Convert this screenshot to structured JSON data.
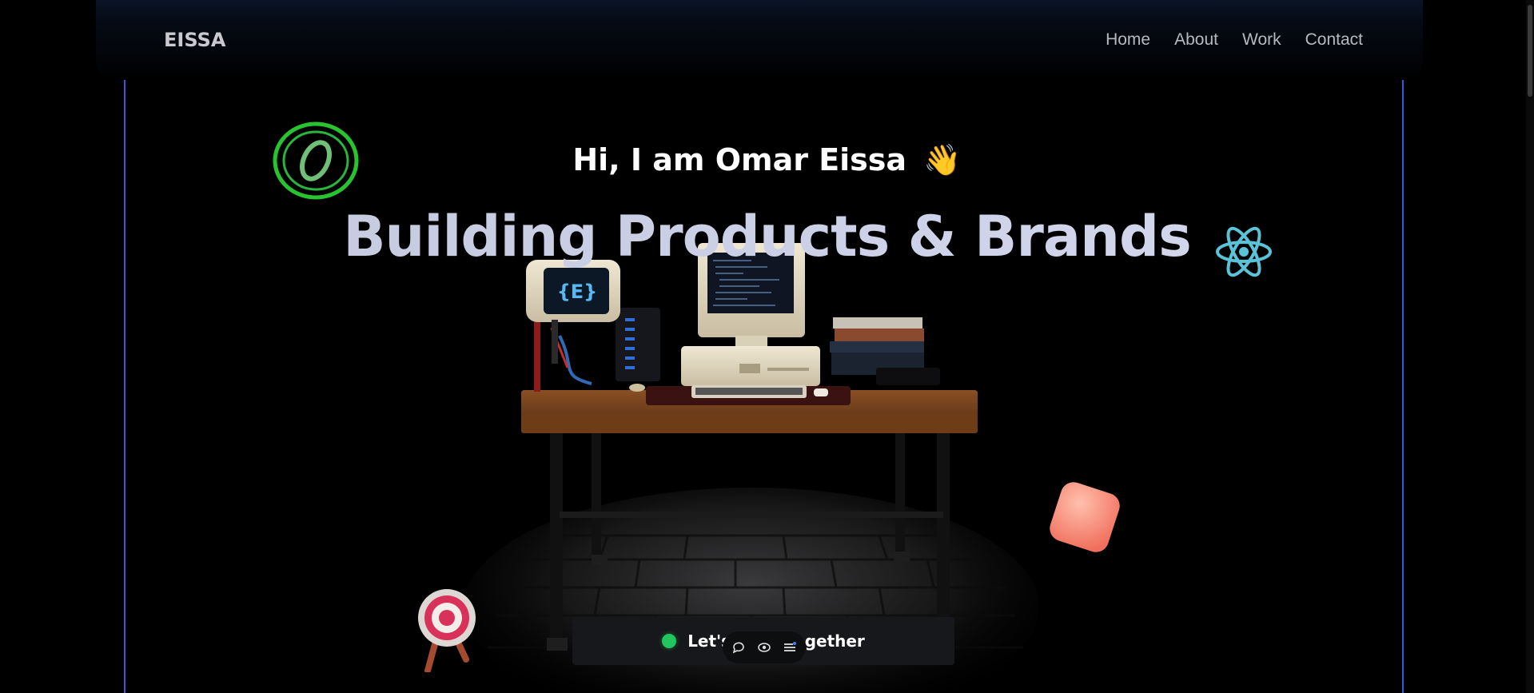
{
  "nav": {
    "logo": "EISSA",
    "links": [
      {
        "label": "Home"
      },
      {
        "label": "About"
      },
      {
        "label": "Work"
      },
      {
        "label": "Contact"
      }
    ]
  },
  "hero": {
    "greeting": "Hi, I am Omar Eissa",
    "greeting_emoji": "👋",
    "headline": "Building Products & Brands"
  },
  "scene": {
    "monitor_badge": "{E}"
  },
  "cta": {
    "label": "Let's work together",
    "status_color": "#22c55e"
  },
  "dock": {
    "icons": [
      "chat-icon",
      "eye-icon",
      "menu-icon"
    ]
  },
  "colors": {
    "frame": "#2f5dd6",
    "headline": "#c8cce2",
    "background": "#000000"
  }
}
